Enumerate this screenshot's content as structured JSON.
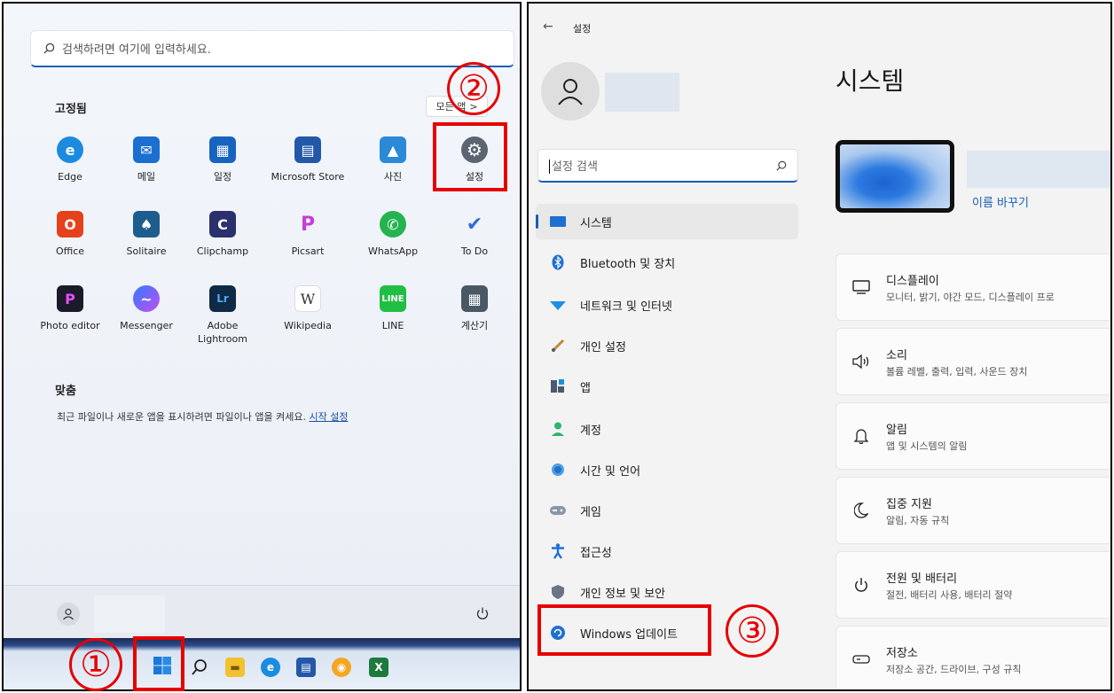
{
  "start_menu": {
    "search_placeholder": "검색하려면 여기에 입력하세요.",
    "pinned_title": "고정됨",
    "all_apps_label": "모든 앱",
    "all_apps_chevron": ">",
    "pinned_apps": [
      {
        "label": "Edge",
        "icon": "edge-icon",
        "color": "#1b8be0",
        "glyph": "e"
      },
      {
        "label": "메일",
        "icon": "mail-icon",
        "color": "#1a6fd1",
        "glyph": "✉"
      },
      {
        "label": "일정",
        "icon": "calendar-icon",
        "color": "#1764c0",
        "glyph": "▦"
      },
      {
        "label": "Microsoft Store",
        "icon": "store-icon",
        "color": "#2358a8",
        "glyph": "▤"
      },
      {
        "label": "사진",
        "icon": "photos-icon",
        "color": "#2a8ad8",
        "glyph": "▲"
      },
      {
        "label": "설정",
        "icon": "settings-gear-icon",
        "color": "#5b6470",
        "glyph": "⚙"
      },
      {
        "label": "Office",
        "icon": "office-icon",
        "color": "#e5411a",
        "glyph": "O"
      },
      {
        "label": "Solitaire",
        "icon": "solitaire-icon",
        "color": "#1f5c8e",
        "glyph": "♠"
      },
      {
        "label": "Clipchamp",
        "icon": "clipchamp-icon",
        "color": "#2a2f6e",
        "glyph": "C"
      },
      {
        "label": "Picsart",
        "icon": "picsart-icon",
        "color": "#c33fd6",
        "glyph": "P"
      },
      {
        "label": "WhatsApp",
        "icon": "whatsapp-icon",
        "color": "#25b350",
        "glyph": "✆"
      },
      {
        "label": "To Do",
        "icon": "todo-icon",
        "color": "#2f6bd8",
        "glyph": "✔"
      },
      {
        "label": "Photo editor",
        "icon": "photo-editor-icon",
        "color": "#1a1a2a",
        "glyph": "P"
      },
      {
        "label": "Messenger",
        "icon": "messenger-icon",
        "color": "#8a4cf0",
        "glyph": "~"
      },
      {
        "label": "Adobe Lightroom",
        "icon": "lightroom-icon",
        "color": "#0f2a44",
        "glyph": "Lr"
      },
      {
        "label": "Wikipedia",
        "icon": "wikipedia-icon",
        "color": "#ffffff",
        "glyph": "W"
      },
      {
        "label": "LINE",
        "icon": "line-icon",
        "color": "#1fbf43",
        "glyph": "L"
      },
      {
        "label": "계산기",
        "icon": "calculator-icon",
        "color": "#4a5866",
        "glyph": "▦"
      }
    ],
    "recommended_title": "맞춤",
    "recommended_text": "최근 파일이나 새로운 앱을 표시하려면 파일이나 앱을 켜세요.",
    "recommended_link": "시작 설정"
  },
  "taskbar": {
    "icons": [
      "windows-start-icon",
      "search-icon",
      "file-explorer-icon",
      "edge-icon",
      "store-icon",
      "chrome-canary-icon",
      "excel-icon"
    ]
  },
  "callouts": {
    "one": "①",
    "two": "②",
    "three": "③",
    "color": "#e60000"
  },
  "settings": {
    "window_title": "설정",
    "search_placeholder": "설정 검색",
    "nav": [
      {
        "label": "시스템",
        "icon": "monitor-icon",
        "active": true
      },
      {
        "label": "Bluetooth 및 장치",
        "icon": "bluetooth-icon"
      },
      {
        "label": "네트워크 및 인터넷",
        "icon": "wifi-icon"
      },
      {
        "label": "개인 설정",
        "icon": "brush-icon"
      },
      {
        "label": "앱",
        "icon": "apps-icon"
      },
      {
        "label": "계정",
        "icon": "account-icon"
      },
      {
        "label": "시간 및 언어",
        "icon": "clock-globe-icon"
      },
      {
        "label": "게임",
        "icon": "gamepad-icon"
      },
      {
        "label": "접근성",
        "icon": "accessibility-icon"
      },
      {
        "label": "개인 정보 및 보안",
        "icon": "shield-icon"
      },
      {
        "label": "Windows 업데이트",
        "icon": "windows-update-icon"
      }
    ],
    "page_title": "시스템",
    "rename_link": "이름 바꾸기",
    "cards": [
      {
        "title": "디스플레이",
        "desc": "모니터, 밝기, 야간 모드, 디스플레이 프로",
        "icon": "display-icon"
      },
      {
        "title": "소리",
        "desc": "볼륨 레벨, 출력, 입력, 사운드 장치",
        "icon": "speaker-icon"
      },
      {
        "title": "알림",
        "desc": "앱 및 시스템의 알림",
        "icon": "bell-icon"
      },
      {
        "title": "집중 지원",
        "desc": "알림, 자동 규칙",
        "icon": "moon-icon"
      },
      {
        "title": "전원 및 배터리",
        "desc": "절전, 배터리 사용, 배터리 절약",
        "icon": "power-icon"
      },
      {
        "title": "저장소",
        "desc": "저장소 공간, 드라이브, 구성 규칙",
        "icon": "storage-icon"
      }
    ],
    "accent_color": "#1a5fb4"
  }
}
